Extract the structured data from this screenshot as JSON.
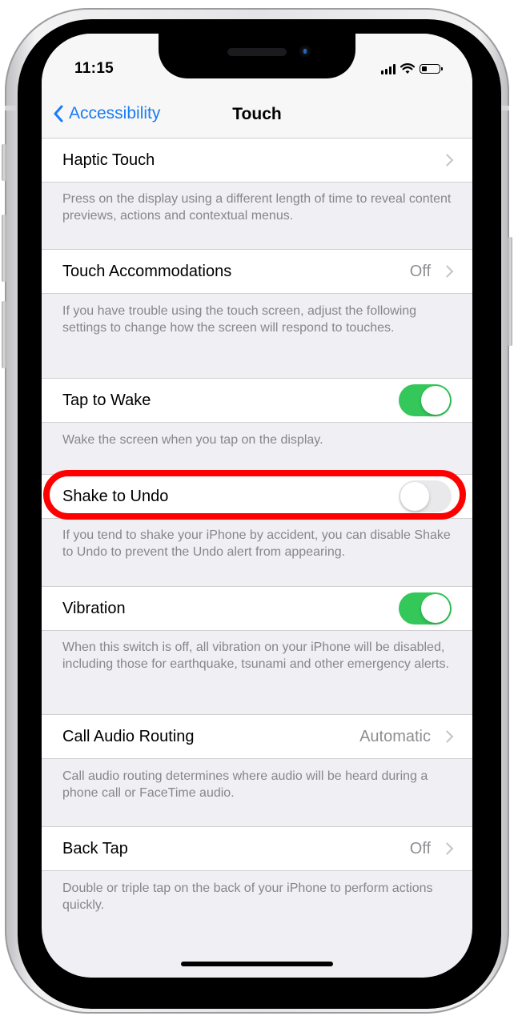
{
  "status_bar": {
    "time": "11:15",
    "icons": [
      "cellular-signal-icon",
      "wifi-icon",
      "battery-low-icon"
    ]
  },
  "nav": {
    "back_label": "Accessibility",
    "back_icon": "chevron-left-icon",
    "title": "Touch"
  },
  "settings": [
    {
      "label": "Haptic Touch",
      "type": "disclosure",
      "value": "",
      "footer": "Press on the display using a different length of time to reveal content previews, actions and contextual menus."
    },
    {
      "label": "Touch Accommodations",
      "type": "disclosure",
      "value": "Off",
      "footer": "If you have trouble using the touch screen, adjust the following settings to change how the screen will respond to touches."
    },
    {
      "label": "Tap to Wake",
      "type": "toggle",
      "value": true,
      "footer": "Wake the screen when you tap on the display."
    },
    {
      "label": "Shake to Undo",
      "type": "toggle",
      "value": false,
      "highlighted": true,
      "footer": "If you tend to shake your iPhone by accident, you can disable Shake to Undo to prevent the Undo alert from appearing."
    },
    {
      "label": "Vibration",
      "type": "toggle",
      "value": true,
      "footer": "When this switch is off, all vibration on your iPhone will be disabled, including those for earthquake, tsunami and other emergency alerts."
    },
    {
      "label": "Call Audio Routing",
      "type": "disclosure",
      "value": "Automatic",
      "footer": "Call audio routing determines where audio will be heard during a phone call or FaceTime audio."
    },
    {
      "label": "Back Tap",
      "type": "disclosure",
      "value": "Off",
      "footer": "Double or triple tap on the back of your iPhone to perform actions quickly."
    }
  ],
  "colors": {
    "accent": "#1a7cf4",
    "toggle_on": "#34c759",
    "toggle_off": "#e9e9eb",
    "highlight": "#ff0000",
    "background": "#efeff4"
  }
}
